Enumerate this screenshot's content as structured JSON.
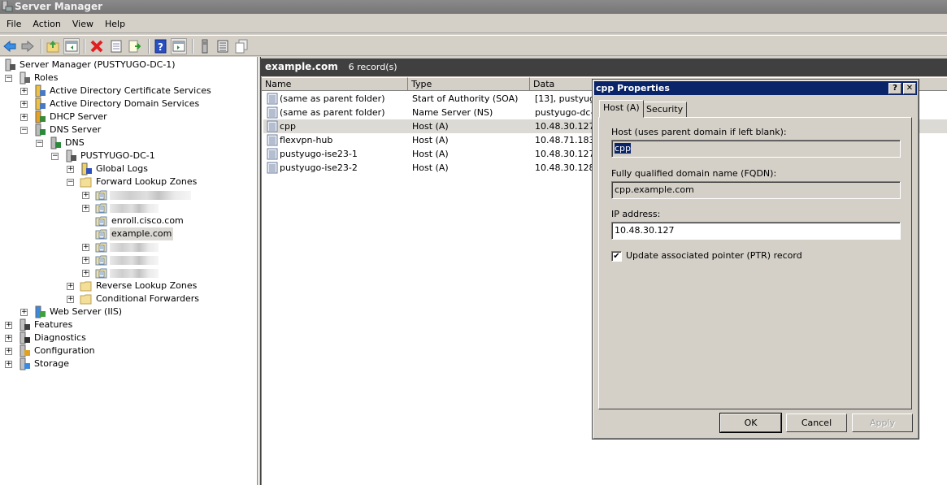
{
  "window": {
    "title": "Server Manager",
    "icon": "server-manager-icon"
  },
  "menu": [
    "File",
    "Action",
    "View",
    "Help"
  ],
  "toolbar": {
    "buttons": [
      {
        "name": "back-button",
        "icon": "arrow-left-icon"
      },
      {
        "name": "forward-button",
        "icon": "arrow-right-icon"
      },
      {
        "name": "up-one-level-button",
        "icon": "folder-up-icon"
      },
      {
        "name": "show-hide-console-tree-button",
        "icon": "console-tree-icon"
      },
      {
        "name": "delete-button",
        "icon": "red-x-icon"
      },
      {
        "name": "properties-button",
        "icon": "properties-icon"
      },
      {
        "name": "export-list-button",
        "icon": "export-icon"
      },
      {
        "name": "help-button",
        "icon": "help-icon"
      },
      {
        "name": "show-hide-action-pane-button",
        "icon": "action-pane-icon"
      },
      {
        "name": "server-button",
        "icon": "server-icon"
      },
      {
        "name": "list-button",
        "icon": "list-icon"
      },
      {
        "name": "copy-button",
        "icon": "copy-icon"
      }
    ]
  },
  "tree": {
    "nodes": [
      {
        "label": "Server Manager (PUSTYUGO-DC-1)",
        "level": 0,
        "expander": "",
        "icon": "server-manager-icon"
      },
      {
        "label": "Roles",
        "level": 1,
        "expander": "minus",
        "icon": "roles-icon"
      },
      {
        "label": "Active Directory Certificate Services",
        "level": 2,
        "expander": "plus",
        "icon": "certificate-services-icon"
      },
      {
        "label": "Active Directory Domain Services",
        "level": 2,
        "expander": "plus",
        "icon": "domain-services-icon"
      },
      {
        "label": "DHCP Server",
        "level": 2,
        "expander": "plus",
        "icon": "dhcp-icon"
      },
      {
        "label": "DNS Server",
        "level": 2,
        "expander": "minus",
        "icon": "dns-server-icon"
      },
      {
        "label": "DNS",
        "level": 3,
        "expander": "minus",
        "icon": "dns-icon"
      },
      {
        "label": "PUSTYUGO-DC-1",
        "level": 4,
        "expander": "minus",
        "icon": "server-icon"
      },
      {
        "label": "Global Logs",
        "level": 5,
        "expander": "plus",
        "icon": "event-log-icon"
      },
      {
        "label": "Forward Lookup Zones",
        "level": 5,
        "expander": "minus",
        "icon": "folder-icon"
      },
      {
        "label": "",
        "level": 6,
        "expander": "plus",
        "icon": "zone-icon",
        "blurred": true
      },
      {
        "label": "",
        "level": 6,
        "expander": "plus",
        "icon": "zone-icon",
        "blurred": true
      },
      {
        "label": "enroll.cisco.com",
        "level": 6,
        "expander": "",
        "icon": "zone-icon"
      },
      {
        "label": "example.com",
        "level": 6,
        "expander": "",
        "icon": "zone-icon",
        "selected": true
      },
      {
        "label": "",
        "level": 6,
        "expander": "plus",
        "icon": "zone-icon",
        "blurred": true
      },
      {
        "label": "",
        "level": 6,
        "expander": "plus",
        "icon": "zone-icon",
        "blurred": true
      },
      {
        "label": "",
        "level": 6,
        "expander": "plus",
        "icon": "zone-icon",
        "blurred": true
      },
      {
        "label": "Reverse Lookup Zones",
        "level": 5,
        "expander": "plus",
        "icon": "folder-icon"
      },
      {
        "label": "Conditional Forwarders",
        "level": 5,
        "expander": "plus",
        "icon": "folder-icon"
      },
      {
        "label": "Web Server (IIS)",
        "level": 2,
        "expander": "plus",
        "icon": "iis-icon"
      },
      {
        "label": "Features",
        "level": 1,
        "expander": "plus",
        "icon": "features-icon"
      },
      {
        "label": "Diagnostics",
        "level": 1,
        "expander": "plus",
        "icon": "diagnostics-icon"
      },
      {
        "label": "Configuration",
        "level": 1,
        "expander": "plus",
        "icon": "configuration-icon"
      },
      {
        "label": "Storage",
        "level": 1,
        "expander": "plus",
        "icon": "storage-icon"
      }
    ]
  },
  "content": {
    "zone": "example.com",
    "record_count": "6 record(s)",
    "columns": [
      "Name",
      "Type",
      "Data"
    ],
    "records": [
      {
        "name": "(same as parent folder)",
        "type": "Start of Authority (SOA)",
        "data": "[13], pustyugo"
      },
      {
        "name": "(same as parent folder)",
        "type": "Name Server (NS)",
        "data": "pustyugo-dc-1"
      },
      {
        "name": "cpp",
        "type": "Host (A)",
        "data": "10.48.30.127",
        "selected": true
      },
      {
        "name": "flexvpn-hub",
        "type": "Host (A)",
        "data": "10.48.71.183"
      },
      {
        "name": "pustyugo-ise23-1",
        "type": "Host (A)",
        "data": "10.48.30.127"
      },
      {
        "name": "pustyugo-ise23-2",
        "type": "Host (A)",
        "data": "10.48.30.128"
      }
    ]
  },
  "dialog": {
    "title": "cpp Properties",
    "help_label": "?",
    "close_label": "✕",
    "tabs": [
      {
        "label": "Host (A)",
        "active": true
      },
      {
        "label": "Security",
        "active": false
      }
    ],
    "host_label": "Host (uses parent domain if left blank):",
    "host_value": "cpp",
    "fqdn_label": "Fully qualified domain name (FQDN):",
    "fqdn_value": "cpp.example.com",
    "ip_label": "IP address:",
    "ip_value": "10.48.30.127",
    "ptr_label": "Update associated pointer (PTR) record",
    "ptr_checked": true,
    "buttons": {
      "ok": "OK",
      "cancel": "Cancel",
      "apply": "Apply"
    }
  },
  "colors": {
    "title_active": "#0a246a",
    "header_dark": "#404040",
    "face": "#d4d0c8",
    "selection_gray": "#dcdad5"
  }
}
